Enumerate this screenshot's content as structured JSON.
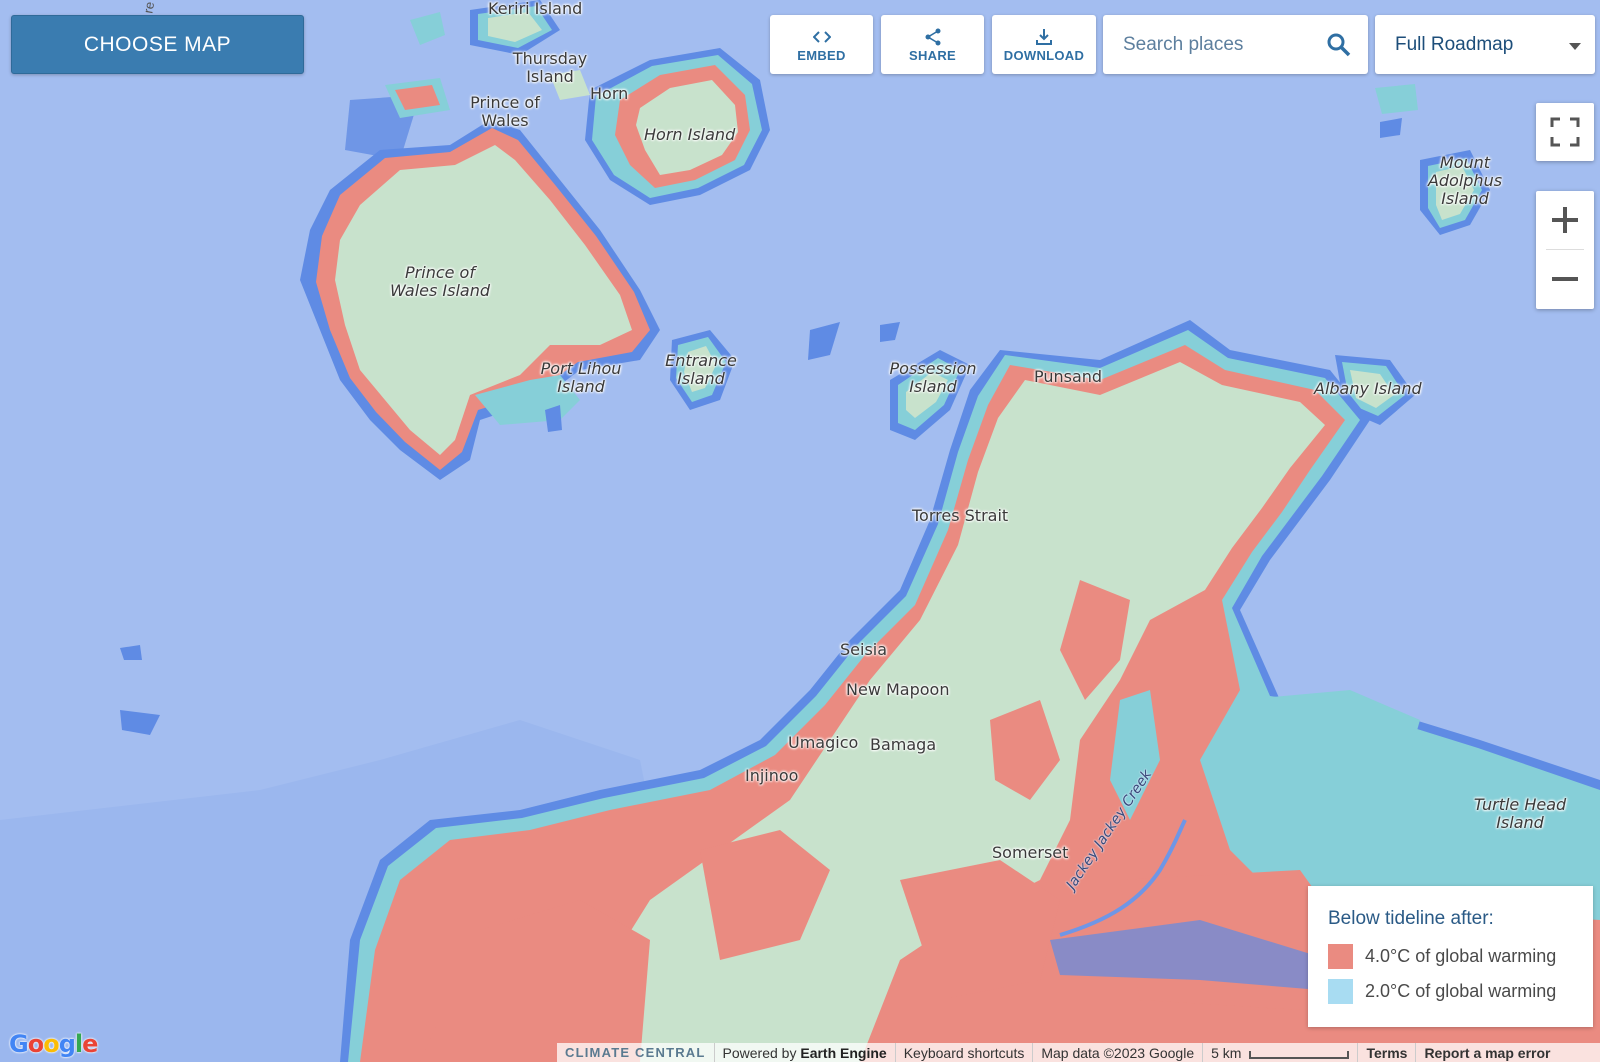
{
  "toolbar": {
    "choose_map": "CHOOSE MAP",
    "embed": "EMBED",
    "share": "SHARE",
    "download": "DOWNLOAD",
    "search_placeholder": "Search places",
    "map_style": "Full Roadmap"
  },
  "legend": {
    "title": "Below tideline after:",
    "items": [
      {
        "label": "4.0°C of global warming",
        "color": "#ea8b81"
      },
      {
        "label": "2.0°C of global warming",
        "color": "#a8dcf2"
      }
    ]
  },
  "places": {
    "keriri": "Keriri Island",
    "thursday": "Thursday Island",
    "horn": "Horn",
    "horn_island": "Horn Island",
    "prince_of_wales_town": "Prince of Wales",
    "prince_of_wales_island": "Prince of Wales Island",
    "port_lihou": "Port Lihou Island",
    "entrance": "Entrance Island",
    "possession": "Possession Island",
    "punsand": "Punsand",
    "albany": "Albany Island",
    "mount_adolphus": "Mount Adolphus Island",
    "torres_strait": "Torres Strait",
    "seisia": "Seisia",
    "new_mapoon": "New Mapoon",
    "umagico": "Umagico",
    "bamaga": "Bamaga",
    "injinoo": "Injinoo",
    "somerset": "Somerset",
    "turtle_head": "Turtle Head Island",
    "jackey_creek": "Jackey Jackey Creek",
    "top_edge_fragment": "re"
  },
  "footer": {
    "brand": "CLIMATE CENTRAL",
    "powered_prefix": "Powered by",
    "powered_name": "Earth Engine",
    "shortcuts": "Keyboard shortcuts",
    "map_data": "Map data ©2023 Google",
    "scale": "5 km",
    "terms": "Terms",
    "report": "Report a map error"
  },
  "google_logo": "Google",
  "colors": {
    "water": "#a3bdf0",
    "land": "#c8e2cc",
    "tide_4c": "#ea8b81",
    "tide_2c": "#86cfd8",
    "button": "#3a7cb0"
  }
}
